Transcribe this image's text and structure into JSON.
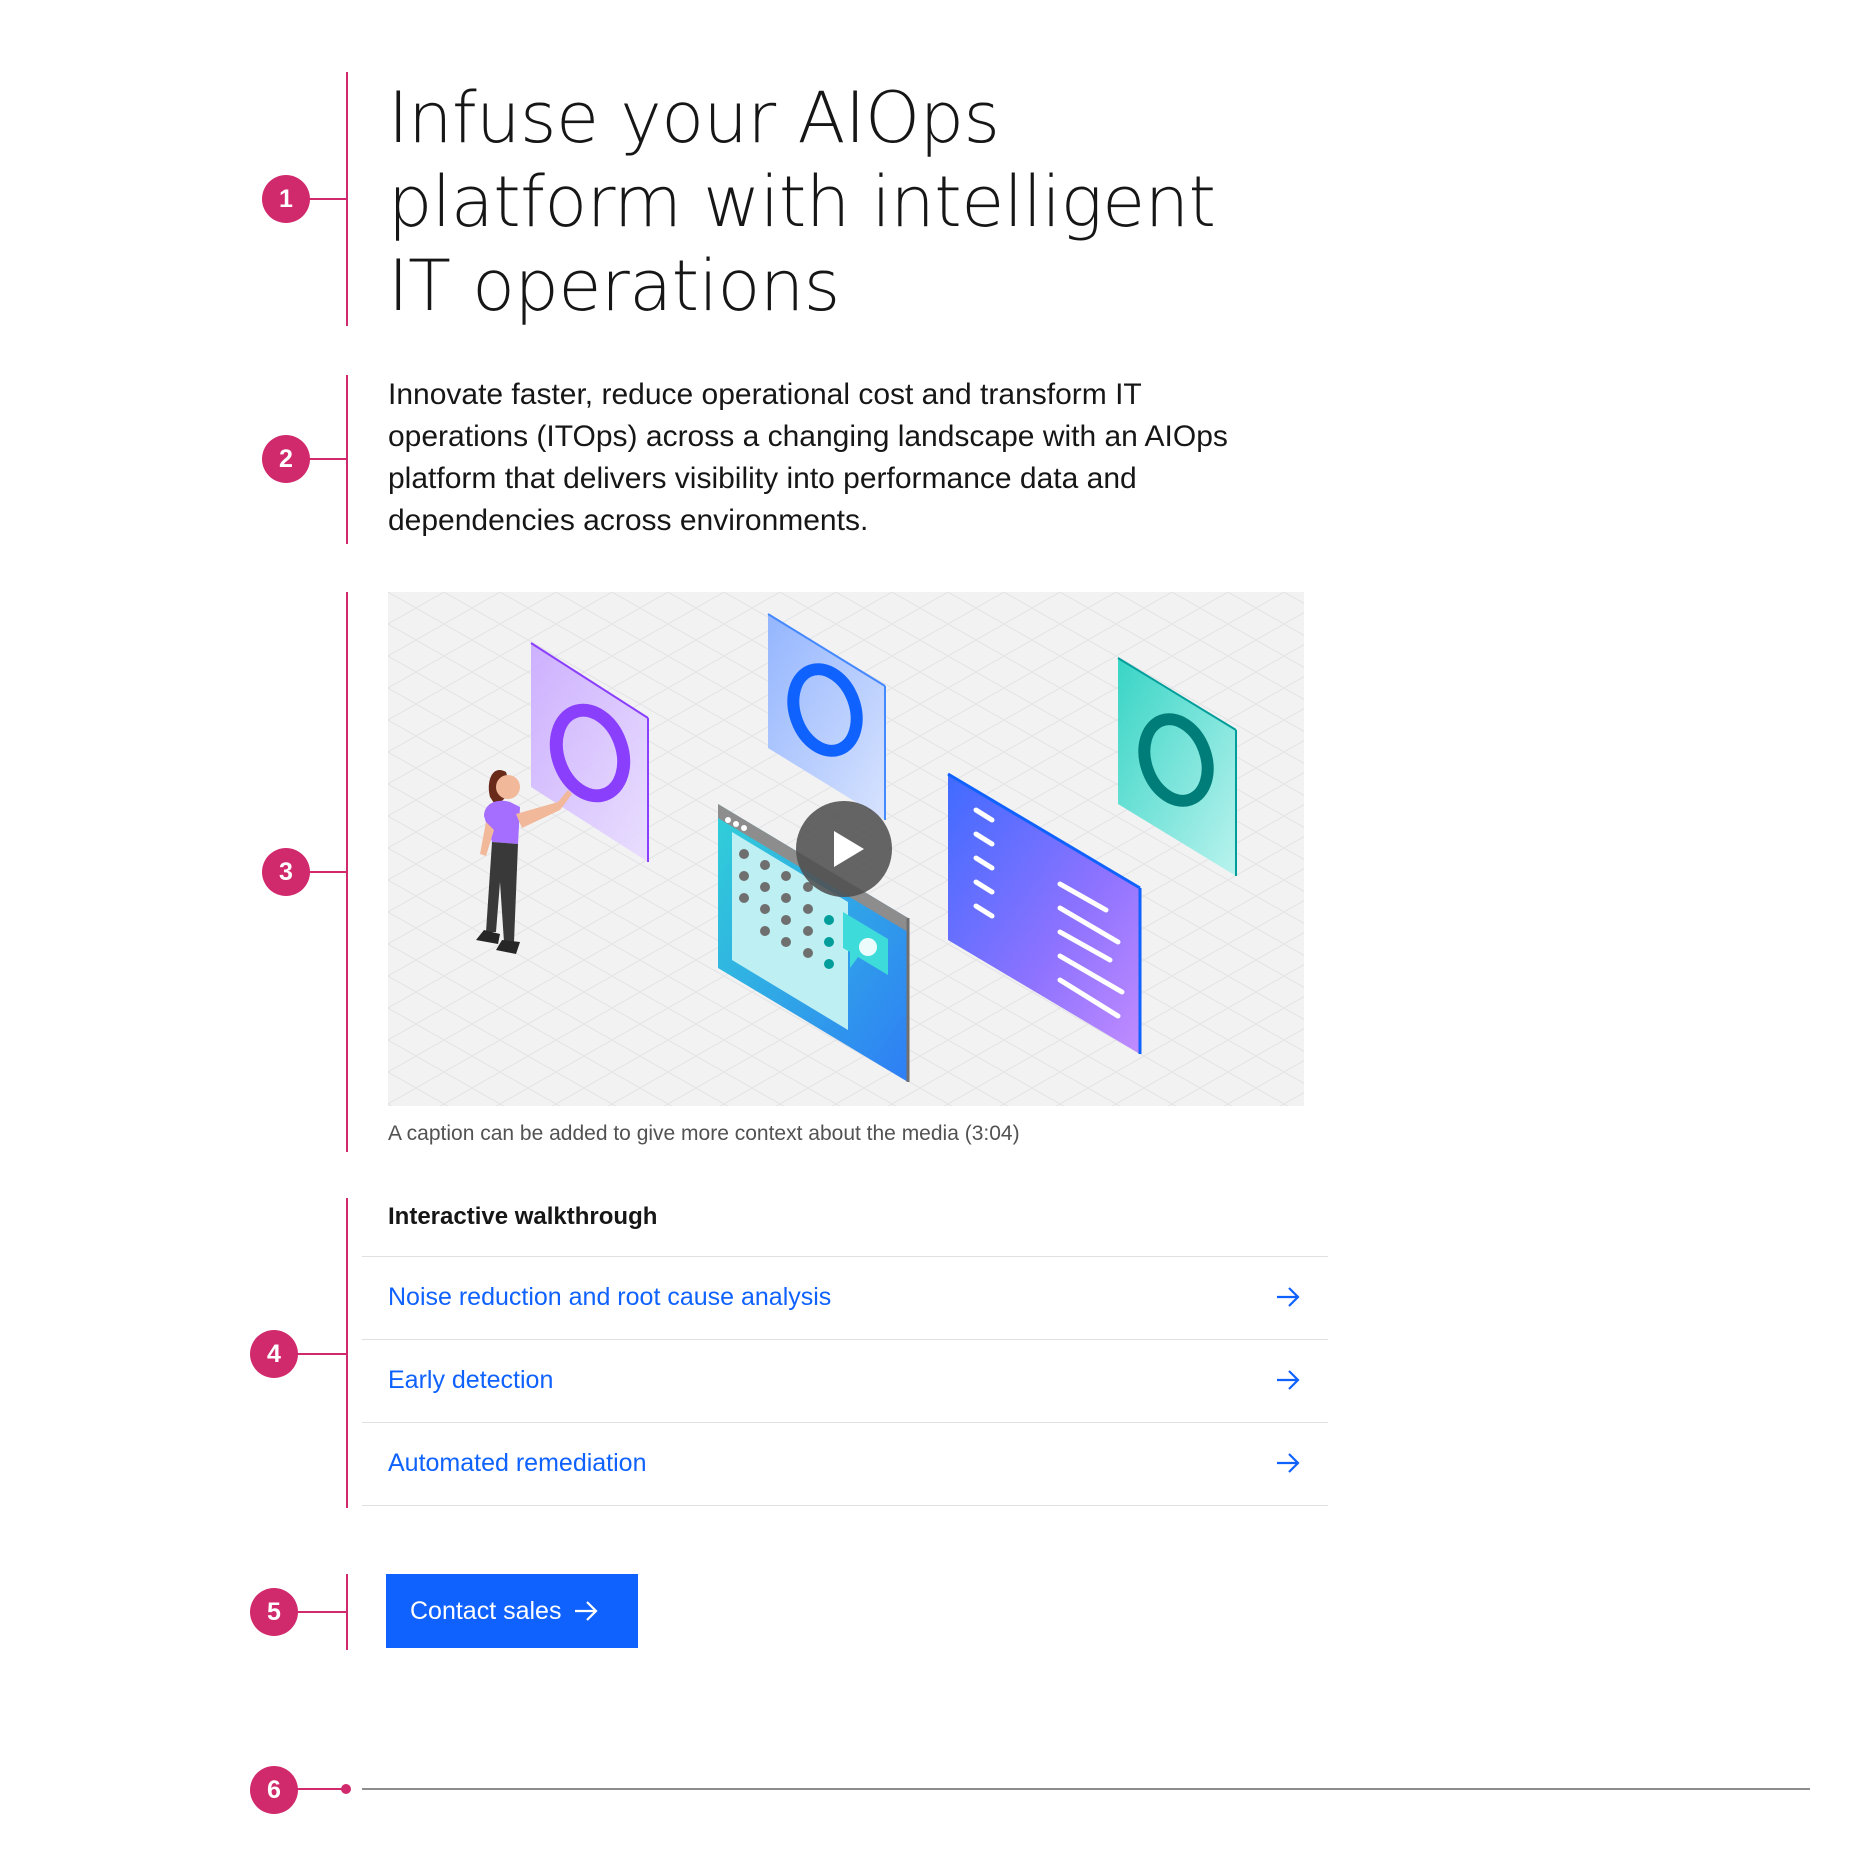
{
  "hero": {
    "title": "Infuse your AIOps platform with intelligent IT operations",
    "description": "Innovate faster, reduce operational cost and transform IT operations (ITOps) across a changing landscape with an AIOps platform that delivers visibility into performance data and dependencies across environments."
  },
  "media": {
    "caption": "A caption can be added to give more context about the media (3:04)",
    "play_icon": "play-icon"
  },
  "walkthrough": {
    "heading": "Interactive walkthrough",
    "links": [
      {
        "label": "Noise reduction and root cause analysis",
        "icon": "arrow-right-icon"
      },
      {
        "label": "Early detection",
        "icon": "arrow-right-icon"
      },
      {
        "label": "Automated remediation",
        "icon": "arrow-right-icon"
      }
    ]
  },
  "cta": {
    "label": "Contact sales",
    "icon": "arrow-right-icon"
  },
  "annotations": [
    "1",
    "2",
    "3",
    "4",
    "5",
    "6"
  ],
  "colors": {
    "annotation": "#d0296c",
    "link": "#0f62fe",
    "button_bg": "#0f62fe",
    "text": "#161616",
    "caption": "#525252",
    "border": "#e0e0e0",
    "divider": "#8d8d8d",
    "media_bg": "#f2f2f3"
  }
}
